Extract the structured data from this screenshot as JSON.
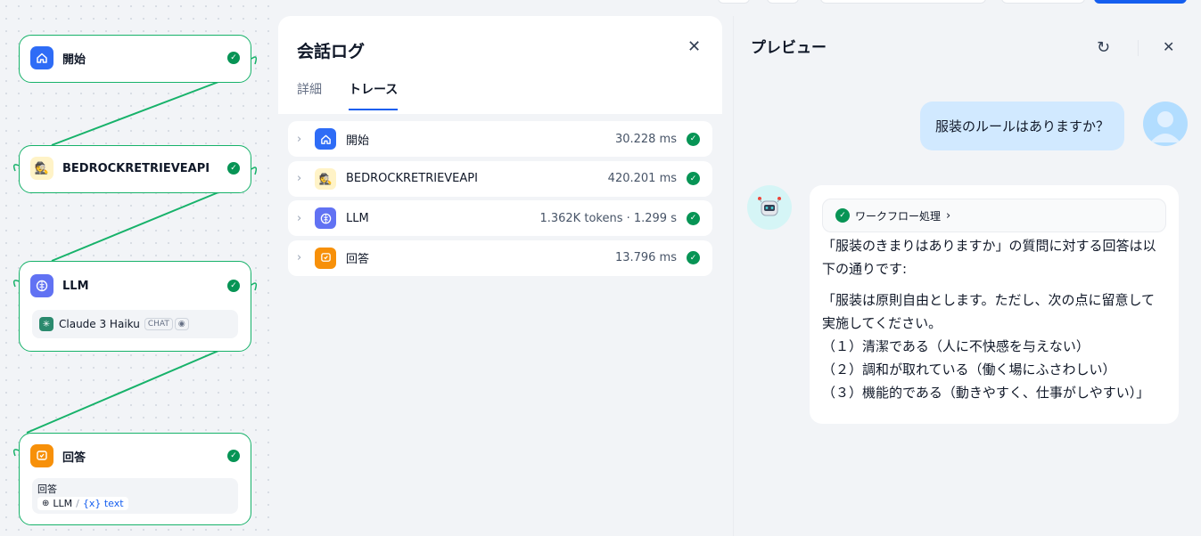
{
  "canvas": {
    "nodes": [
      {
        "title": "開始",
        "icon": "home-icon",
        "color": "#2e6cf6"
      },
      {
        "title": "BEDROCKRETRIEVEAPI",
        "icon": "detective-icon",
        "color": "#fff3c7"
      },
      {
        "title": "LLM",
        "icon": "brain-icon",
        "color": "#6172f3"
      },
      {
        "title": "回答",
        "icon": "answer-icon",
        "color": "#f79009"
      }
    ],
    "llm_model": {
      "name": "Claude 3 Haiku",
      "badge": "CHAT"
    },
    "answer_box": {
      "label": "回答",
      "source": "LLM",
      "separator": "/",
      "variable": "{x} text"
    }
  },
  "log_panel": {
    "title": "会話ログ",
    "tabs": [
      {
        "label": "詳細",
        "active": false
      },
      {
        "label": "トレース",
        "active": true
      }
    ],
    "traces": [
      {
        "name": "開始",
        "value": "30.228 ms",
        "icon": "home-icon",
        "color": "#2e6cf6"
      },
      {
        "name": "BEDROCKRETRIEVEAPI",
        "value": "420.201 ms",
        "icon": "detective-icon",
        "color": "#fff3c7"
      },
      {
        "name": "LLM",
        "value": "1.362K tokens · 1.299 s",
        "icon": "brain-icon",
        "color": "#6172f3"
      },
      {
        "name": "回答",
        "value": "13.796 ms",
        "icon": "answer-icon",
        "color": "#f79009"
      }
    ]
  },
  "preview": {
    "title": "プレビュー",
    "user_message": "服装のルールはありますか？",
    "workflow_label": "ワークフロー処理",
    "answer_lines": [
      "「服装のきまりはありますか」の質問に対する回答は以",
      "下の通りです:"
    ],
    "answer_quote": [
      "「服装は原則自由とします。ただし、次の点に留意して",
      "実施してください。",
      "（１）清潔である（人に不快感を与えない）",
      "（２）調和が取れている（働く場にふさわしい）",
      "（３）機能的である（動きやすく、仕事がしやすい）」"
    ]
  },
  "colors": {
    "success": "#079455",
    "accent": "#155eef",
    "user_bubble": "#d1e9ff"
  }
}
